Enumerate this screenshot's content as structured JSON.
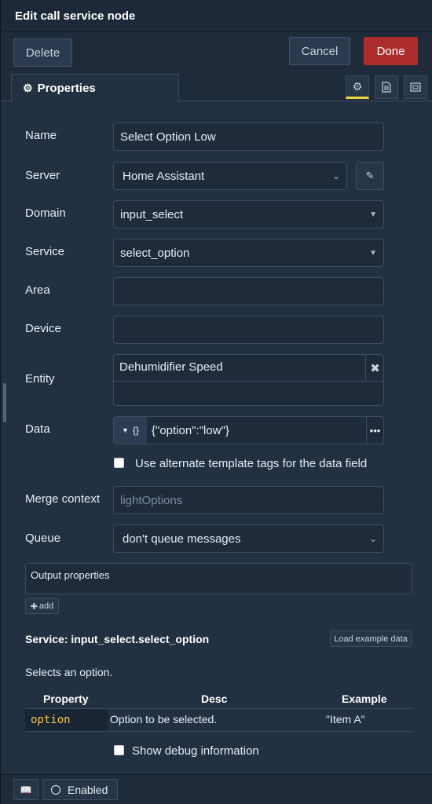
{
  "dialog": {
    "title": "Edit call service node"
  },
  "toolbar": {
    "delete_label": "Delete",
    "cancel_label": "Cancel",
    "done_label": "Done",
    "done_color": "#ad2d2d"
  },
  "tabs": {
    "properties_label": "Properties",
    "icons": [
      "gear-icon",
      "document-icon",
      "appearance-icon"
    ]
  },
  "form": {
    "name": {
      "label": "Name",
      "value": "Select Option Low"
    },
    "server": {
      "label": "Server",
      "value": "Home Assistant"
    },
    "domain": {
      "label": "Domain",
      "value": "input_select"
    },
    "service": {
      "label": "Service",
      "value": "select_option"
    },
    "area": {
      "label": "Area",
      "value": ""
    },
    "device": {
      "label": "Device",
      "value": ""
    },
    "entity": {
      "label": "Entity",
      "value": "Dehumidifier Speed"
    },
    "data": {
      "label": "Data",
      "type_label": "{}",
      "value": "{\"option\":\"low\"}"
    },
    "alt_template": {
      "label": "Use alternate template tags for the data field",
      "checked": false
    },
    "merge_context": {
      "label": "Merge context",
      "placeholder": "lightOptions"
    },
    "queue": {
      "label": "Queue",
      "value": "don't queue messages"
    }
  },
  "output": {
    "label": "Output properties",
    "add_label": "add"
  },
  "service_info": {
    "title": "Service: input_select.select_option",
    "load_example_label": "Load example data",
    "description": "Selects an option.",
    "columns": [
      "Property",
      "Desc",
      "Example"
    ],
    "rows": [
      {
        "property": "option",
        "desc": "Option to be selected.",
        "example": "\"Item A\""
      }
    ]
  },
  "debug": {
    "label": "Show debug information",
    "checked": false
  },
  "footer": {
    "enabled_label": "Enabled"
  }
}
